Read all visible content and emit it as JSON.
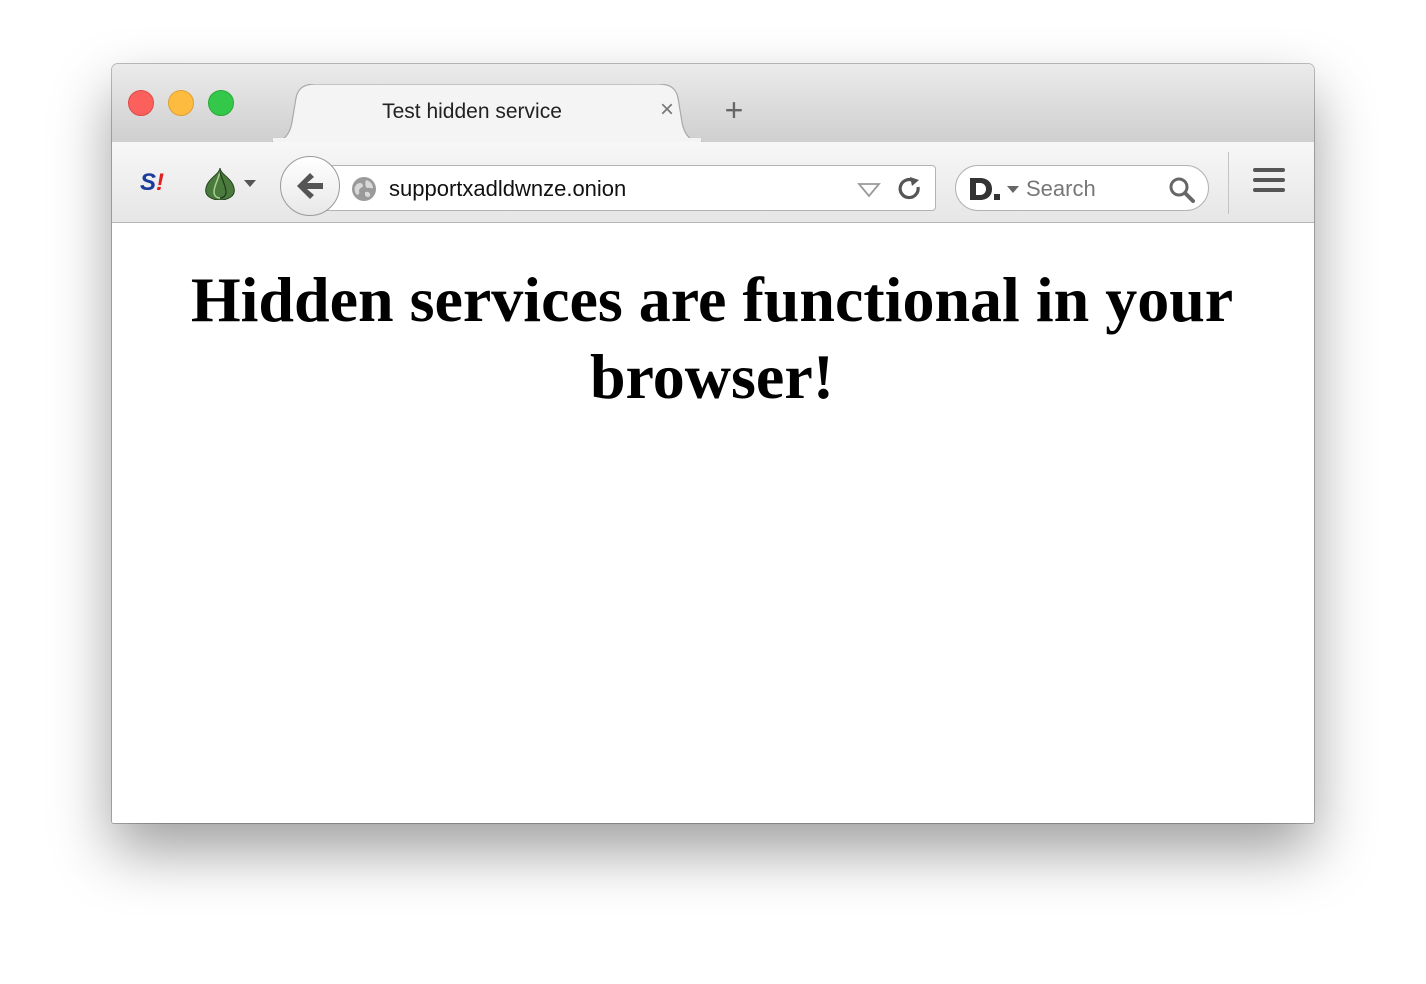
{
  "tab": {
    "title": "Test hidden service",
    "close_glyph": "×",
    "new_tab_glyph": "+"
  },
  "toolbar": {
    "addon_s_letter": "S",
    "addon_s_mark": "!",
    "addon_onion_icon": "onion-icon",
    "back_icon": "back-arrow-icon",
    "url": "supportxadldwnze.onion",
    "url_icon": "globe-icon",
    "reload_icon": "reload-icon",
    "search_engine_icon": "duckduckgo-d-icon",
    "search_placeholder": "Search",
    "search_icon": "magnifier-icon",
    "menu_icon": "hamburger-menu-icon"
  },
  "page": {
    "heading": "Hidden services are functional in your browser!"
  },
  "colors": {
    "traffic_close": "#fc605c",
    "traffic_minimize": "#fdbc40",
    "traffic_zoom": "#34c84a",
    "titlebar": "#d6d6d6"
  }
}
